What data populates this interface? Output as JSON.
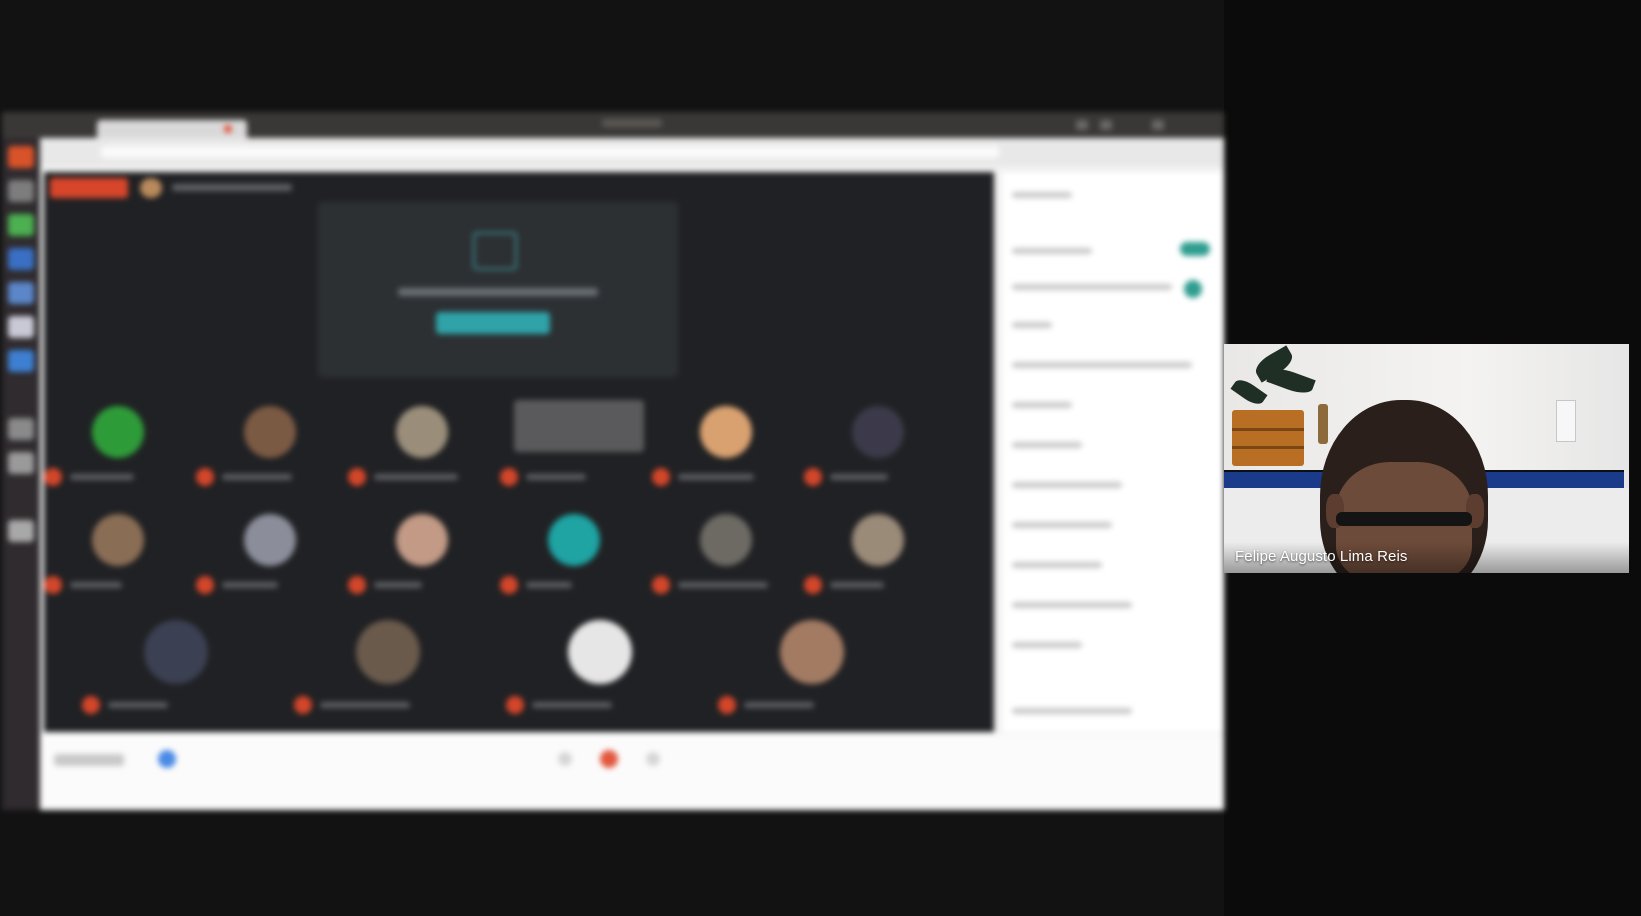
{
  "self_view": {
    "participant_name": "Felipe Augusto Lima Reis"
  },
  "colors": {
    "background": "#0b0b0b",
    "recording_badge": "#d7462b",
    "accent_teal": "#2fa3a8",
    "mic_muted_red": "#d3462a",
    "side_panel_toggle": "#2f9d8f"
  },
  "icons": [
    "recording-badge-icon",
    "presentation-icon",
    "mic-muted-icon",
    "info-icon",
    "mic-icon",
    "end-call-icon",
    "camera-icon",
    "toggle-switch"
  ]
}
